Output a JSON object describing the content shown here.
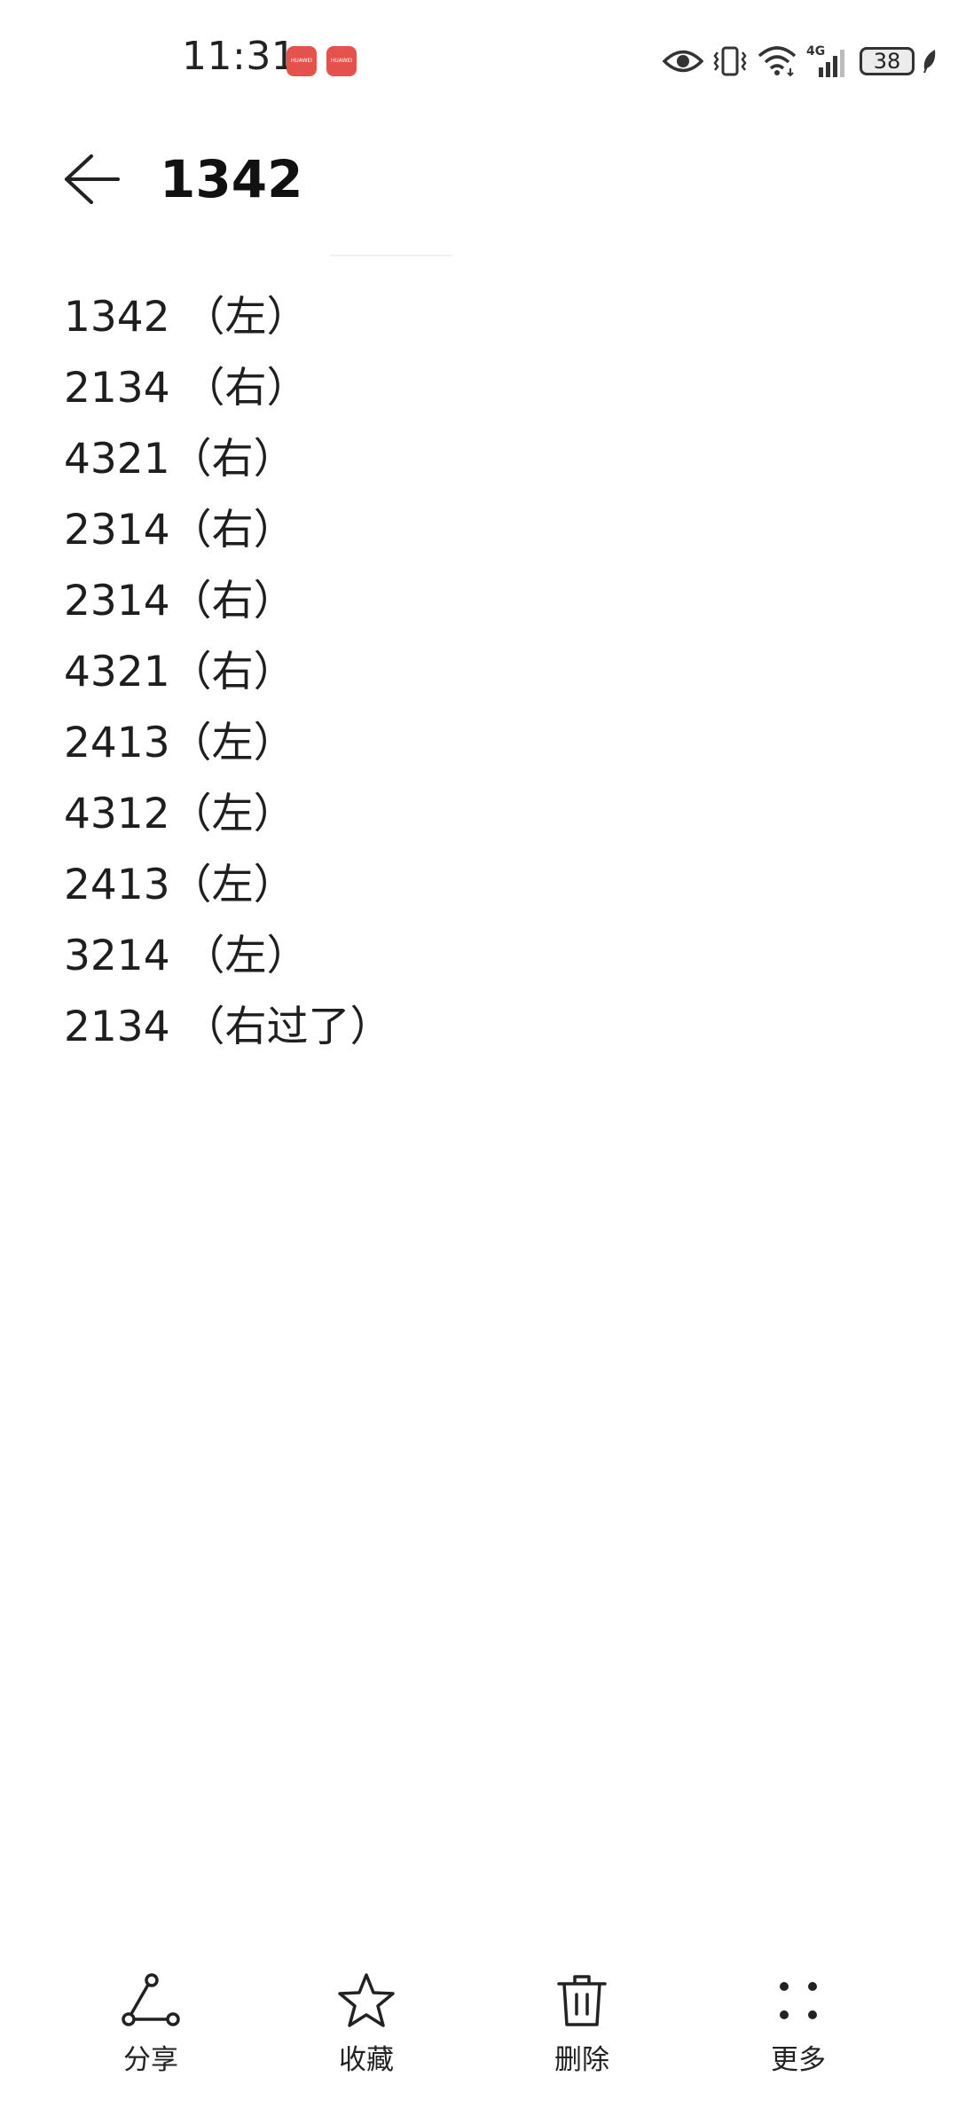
{
  "status_bar": {
    "time": "11:31",
    "app_badges": [
      "HUAWEI",
      "HUAWEI"
    ],
    "battery_level": "38",
    "icons": [
      "eye-icon",
      "vibrate-icon",
      "wifi-icon",
      "signal-4g-icon",
      "battery-icon",
      "leaf-icon"
    ],
    "network_label": "4G"
  },
  "header": {
    "back_icon": "arrow-left-icon",
    "title": "1342"
  },
  "note": {
    "lines": [
      "1342 （左）",
      "2134 （右）",
      "4321（右）",
      "2314（右）",
      "2314（右）",
      "4321（右）",
      "2413（左）",
      "4312（左）",
      "2413（左）",
      "3214 （左）",
      "2134 （右过了）"
    ]
  },
  "toolbar": {
    "share_label": "分享",
    "favorite_label": "收藏",
    "delete_label": "删除",
    "more_label": "更多",
    "icons": [
      "share-icon",
      "star-icon",
      "trash-icon",
      "more-dots-icon"
    ]
  }
}
